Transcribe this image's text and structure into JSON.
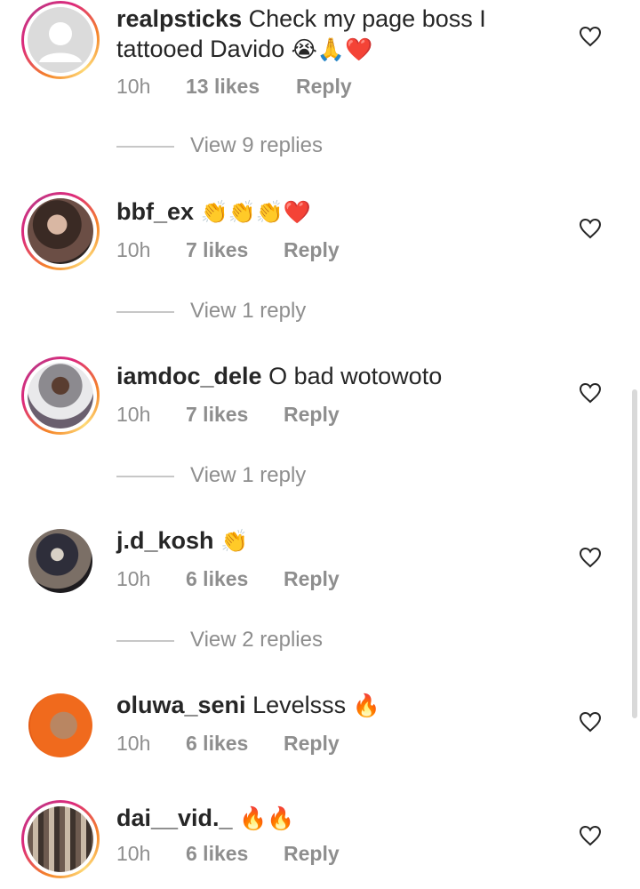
{
  "comments": [
    {
      "username": "realpsticks",
      "text": "Check my page boss I tattooed Davido",
      "emojis": "😭🙏❤️",
      "time": "10h",
      "likes": "13 likes",
      "reply": "Reply",
      "view_replies": "View 9 replies",
      "avatar": "default-avatar-icon",
      "ring": true
    },
    {
      "username": "bbf_ex",
      "text": "",
      "emojis": "👏👏👏❤️",
      "time": "10h",
      "likes": "7 likes",
      "reply": "Reply",
      "view_replies": "View 1 reply",
      "ring": true
    },
    {
      "username": "iamdoc_dele",
      "text": "O bad wotowoto",
      "emojis": "",
      "time": "10h",
      "likes": "7 likes",
      "reply": "Reply",
      "view_replies": "View 1 reply",
      "ring": true
    },
    {
      "username": "j.d_kosh",
      "text": "",
      "emojis": "👏",
      "time": "10h",
      "likes": "6 likes",
      "reply": "Reply",
      "view_replies": "View 2 replies",
      "ring": false
    },
    {
      "username": "oluwa_seni",
      "text": "Levelsss",
      "emojis": "🔥",
      "time": "10h",
      "likes": "6 likes",
      "reply": "Reply",
      "view_replies": "",
      "ring": false
    },
    {
      "username": "dai__vid._",
      "text": "",
      "emojis": "🔥🔥",
      "time": "10h",
      "likes": "6 likes",
      "reply": "Reply",
      "view_replies": "",
      "ring": true
    }
  ],
  "icons": {
    "like": "heart-outline-icon"
  },
  "colors": {
    "username": "#262626",
    "meta": "#8e8e8e",
    "ring_start": "#f58529",
    "ring_end": "#dd2a7b"
  }
}
